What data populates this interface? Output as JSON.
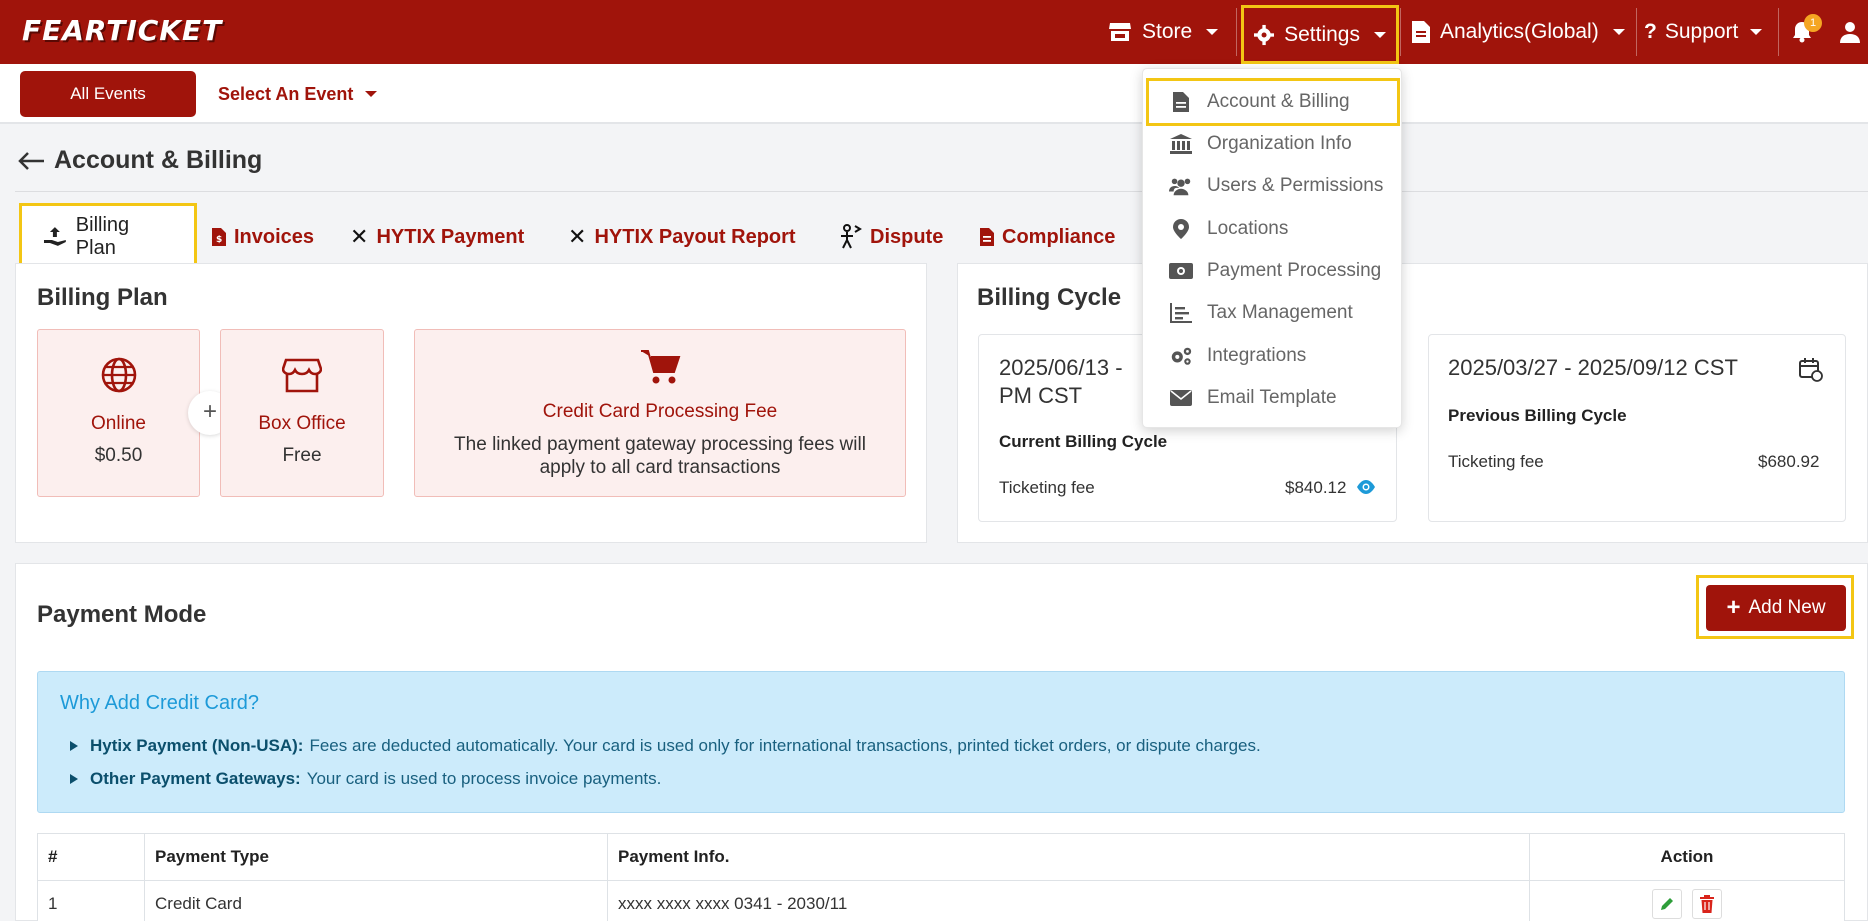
{
  "navbar": {
    "logo": "FEARTICKET",
    "store": "Store",
    "settings": "Settings",
    "analytics": "Analytics(Global)",
    "support": "Support",
    "notif_count": "1"
  },
  "subbar": {
    "all_events": "All Events",
    "select_event": "Select An Event"
  },
  "page": {
    "title": "Account & Billing"
  },
  "tabs": [
    {
      "label": "Billing Plan",
      "icon": "hand-money-icon"
    },
    {
      "label": "Invoices",
      "icon": "invoice-icon"
    },
    {
      "label": "HYTIX Payment",
      "icon": "hytix-icon"
    },
    {
      "label": "HYTIX Payout Report",
      "icon": "hytix-icon"
    },
    {
      "label": "Dispute",
      "icon": "dispute-icon"
    },
    {
      "label": "Compliance",
      "icon": "document-icon"
    }
  ],
  "billing_plan": {
    "title": "Billing Plan",
    "online": {
      "name": "Online",
      "price": "$0.50"
    },
    "box_office": {
      "name": "Box Office",
      "price": "Free"
    },
    "plus": "+",
    "card_fee": {
      "title": "Credit Card Processing Fee",
      "text": "The linked payment gateway processing fees will apply to all card transactions"
    }
  },
  "billing_cycle": {
    "title": "Billing Cycle",
    "current": {
      "range_line1": "2025/06/13 -",
      "range_line2": "PM CST",
      "label": "Current Billing Cycle",
      "fee_label": "Ticketing fee",
      "fee_value": "$840.12"
    },
    "previous": {
      "range": "2025/03/27 - 2025/09/12 CST",
      "label": "Previous Billing Cycle",
      "fee_label": "Ticketing fee",
      "fee_value": "$680.92"
    }
  },
  "settings_menu": [
    {
      "label": "Account & Billing",
      "icon": "file-icon"
    },
    {
      "label": "Organization Info",
      "icon": "bank-icon"
    },
    {
      "label": "Users & Permissions",
      "icon": "users-icon"
    },
    {
      "label": "Locations",
      "icon": "location-pin-icon"
    },
    {
      "label": "Payment Processing",
      "icon": "money-bill-icon"
    },
    {
      "label": "Tax Management",
      "icon": "chart-icon"
    },
    {
      "label": "Integrations",
      "icon": "gears-icon"
    },
    {
      "label": "Email Template",
      "icon": "envelope-icon"
    }
  ],
  "payment_mode": {
    "title": "Payment Mode",
    "add_new": "Add New",
    "info_title": "Why Add Credit Card?",
    "info": [
      {
        "bold": "Hytix Payment (Non-USA):",
        "text": "Fees are deducted automatically. Your card is used only for international transactions, printed ticket orders, or dispute charges."
      },
      {
        "bold": "Other Payment Gateways:",
        "text": "Your card is used to process invoice payments."
      }
    ],
    "columns": [
      "#",
      "Payment Type",
      "Payment Info.",
      "Action"
    ],
    "rows": [
      {
        "num": "1",
        "type": "Credit Card",
        "info": "xxxx xxxx xxxx 0341 - 2030/11"
      }
    ]
  }
}
